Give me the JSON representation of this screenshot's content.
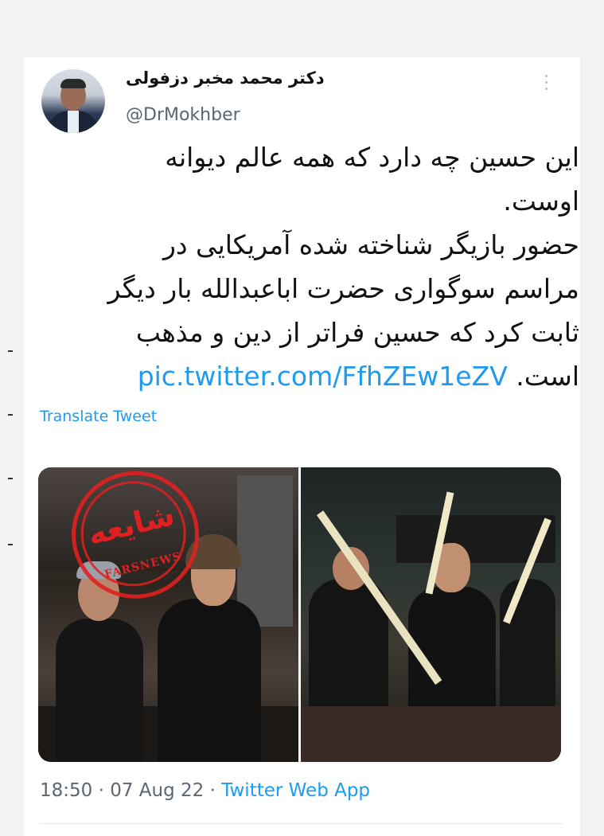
{
  "tweet": {
    "author": {
      "display_name": "دکتر محمد مخبر دزفولی",
      "handle": "@DrMokhber",
      "avatar_icon": "profile-avatar"
    },
    "text_lines": [
      "این حسین چه دارد که همه عالم دیوانه",
      "اوست.",
      "حضور بازیگر شناخته شده آمریکایی در",
      "مراسم سوگواری حضرت اباعبدالله بار دیگر",
      "ثابت کرد که حسین فراتر از دین و مذهب"
    ],
    "last_line_text": "است.",
    "link": "pic.twitter.com/FfhZEw1eZV",
    "translate_label": "Translate Tweet",
    "stamp": {
      "word": "شایعه",
      "brand": "FARSNEWS",
      "color": "#e02020"
    },
    "time": "18:50",
    "date": "07 Aug 22",
    "source": "Twitter Web App",
    "separator": "·"
  },
  "colors": {
    "link": "#1d9bf0",
    "secondary_text": "#5b6670",
    "primary_text": "#111111",
    "background": "#ffffff"
  },
  "icons": {
    "more": "more-vertical-icon"
  }
}
